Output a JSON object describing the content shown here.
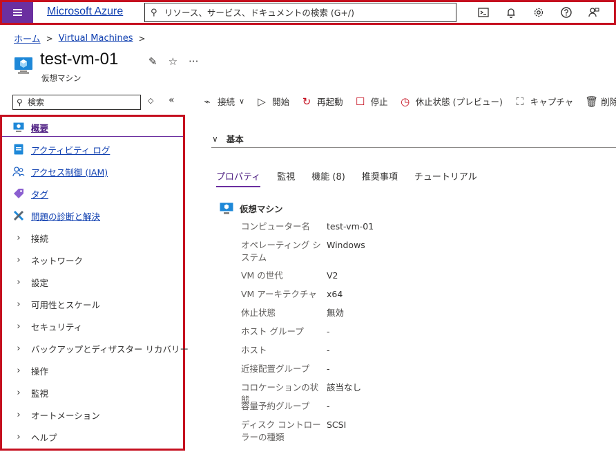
{
  "topbar": {
    "brand": "Microsoft Azure",
    "search_placeholder": "リソース、サービス、ドキュメントの検索 (G+/)",
    "icons": [
      "cloud-shell-icon",
      "bell-icon",
      "gear-icon",
      "help-icon",
      "feedback-icon"
    ]
  },
  "breadcrumb": {
    "home": "ホーム",
    "vms": "Virtual Machines"
  },
  "page": {
    "title": "test-vm-01",
    "subtitle": "仮想マシン",
    "more": "···"
  },
  "left": {
    "search_placeholder": "検索",
    "items": [
      {
        "label": "概要",
        "icon": "monitor-icon"
      },
      {
        "label": "アクティビティ ログ",
        "icon": "log-icon"
      },
      {
        "label": "アクセス制御 (IAM)",
        "icon": "people-icon"
      },
      {
        "label": "タグ",
        "icon": "tag-icon"
      },
      {
        "label": "問題の診断と解決",
        "icon": "wrench-icon"
      },
      {
        "label": "接続"
      },
      {
        "label": "ネットワーク"
      },
      {
        "label": "設定"
      },
      {
        "label": "可用性とスケール"
      },
      {
        "label": "セキュリティ"
      },
      {
        "label": "バックアップとディザスター リカバリー"
      },
      {
        "label": "操作"
      },
      {
        "label": "監視"
      },
      {
        "label": "オートメーション"
      },
      {
        "label": "ヘルプ"
      }
    ]
  },
  "toolbar": {
    "connect": "接続",
    "start": "開始",
    "restart": "再起動",
    "stop": "停止",
    "hibernate": "休止状態 (プレビュー)",
    "capture": "キャプチャ",
    "delete": "削除"
  },
  "essentials": {
    "title": "基本"
  },
  "tabs": [
    "プロパティ",
    "監視",
    "機能 (8)",
    "推奨事項",
    "チュートリアル"
  ],
  "properties": {
    "heading": "仮想マシン",
    "rows": [
      {
        "k": "コンピューター名",
        "v": "test-vm-01"
      },
      {
        "k": "オペレーティング システム",
        "v": "Windows"
      },
      {
        "k": "VM の世代",
        "v": "V2"
      },
      {
        "k": "VM アーキテクチャ",
        "v": "x64"
      },
      {
        "k": "休止状態",
        "v": "無効"
      },
      {
        "k": "ホスト グループ",
        "v": "-"
      },
      {
        "k": "ホスト",
        "v": "-"
      },
      {
        "k": "近接配置グループ",
        "v": "-"
      },
      {
        "k": "コロケーションの状態",
        "v": "該当なし"
      },
      {
        "k": "容量予約グループ",
        "v": "-"
      },
      {
        "k": "ディスク コントローラーの種類",
        "v": "SCSI"
      }
    ]
  },
  "colors": {
    "accent": "#6b2fa0",
    "link": "#0f3fb0",
    "highlight_border": "#c50f1f"
  }
}
